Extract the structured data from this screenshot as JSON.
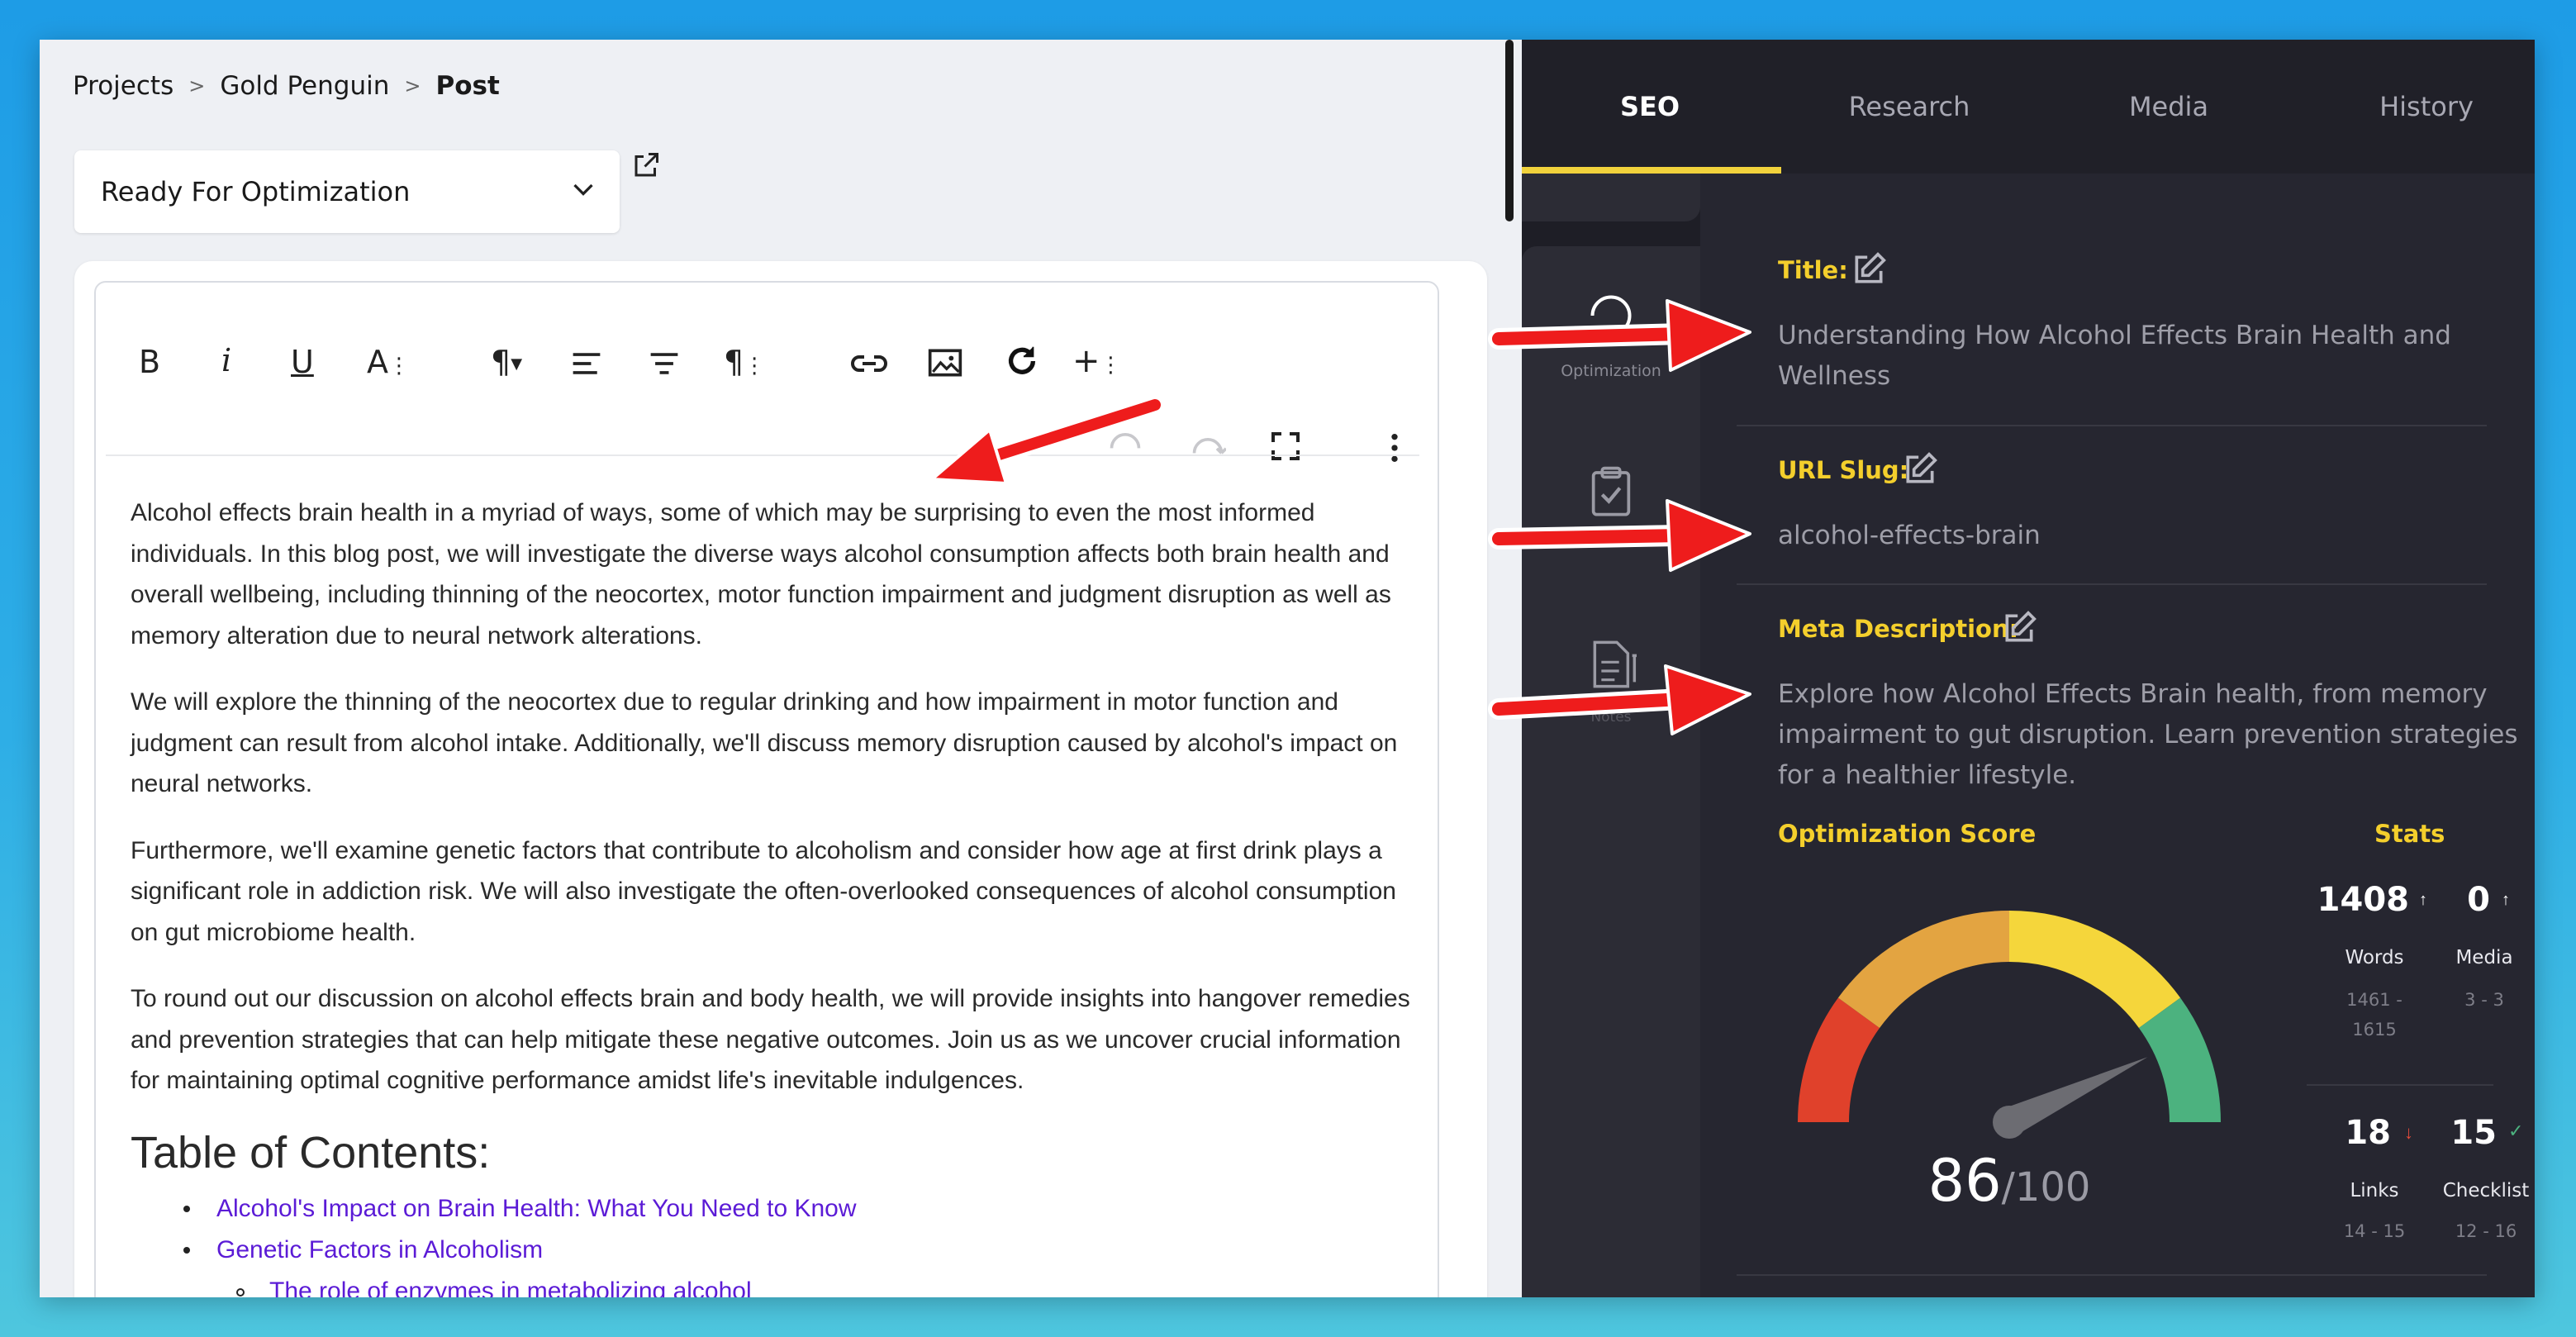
{
  "breadcrumb": {
    "items": [
      "Projects",
      "Gold Penguin"
    ],
    "current": "Post"
  },
  "status_dropdown": {
    "value": "Ready For Optimization"
  },
  "toolbar": {
    "icons": [
      "bold-icon",
      "italic-icon",
      "underline-icon",
      "font-size-icon",
      "paragraph-icon",
      "align-left-icon",
      "align-center-icon",
      "paragraph-format-icon",
      "link-icon",
      "image-icon",
      "redo-icon",
      "insert-more-icon",
      "undo-icon",
      "redo-icon",
      "fullscreen-icon",
      "more-vertical-icon"
    ],
    "bold": "B",
    "italic": "i",
    "underline": "U",
    "font_size": "A"
  },
  "content": {
    "paragraphs": [
      "Alcohol effects brain health in a myriad of ways, some of which may be surprising to even the most informed individuals. In this blog post, we will investigate the diverse ways alcohol consumption affects both brain health and overall wellbeing, including thinning of the neocortex, motor function impairment and judgment disruption as well as memory alteration due to neural network alterations.",
      "We will explore the thinning of the neocortex due to regular drinking and how impairment in motor function and judgment can result from alcohol intake. Additionally, we'll discuss memory disruption caused by alcohol's impact on neural networks.",
      "Furthermore, we'll examine genetic factors that contribute to alcoholism and consider how age at first drink plays a significant role in addiction risk. We will also investigate the often-overlooked consequences of alcohol consumption on gut microbiome health.",
      "To round out our discussion on alcohol effects brain and body health, we will provide insights into hangover remedies and prevention strategies that can help mitigate these negative outcomes. Join us as we uncover crucial information for maintaining optimal cognitive performance amidst life's inevitable indulgences."
    ],
    "toc_heading": "Table of Contents:",
    "toc_items": [
      "Alcohol's Impact on Brain Health: What You Need to Know",
      "Genetic Factors in Alcoholism",
      "The role of enzymes in metabolizing alcohol"
    ]
  },
  "tabs": [
    {
      "label": "SEO",
      "active": true
    },
    {
      "label": "Research"
    },
    {
      "label": "Media"
    },
    {
      "label": "History"
    }
  ],
  "rail": {
    "items": [
      "Optimization",
      "Checklist",
      "Notes"
    ]
  },
  "seo": {
    "title_label": "Title:",
    "title_value": "Understanding How Alcohol Effects Brain Health and Wellness",
    "slug_label": "URL Slug:",
    "slug_value": "alcohol-effects-brain",
    "meta_label": "Meta Description:",
    "meta_value": "Explore how Alcohol Effects Brain health, from memory impairment to gut disruption. Learn prevention strategies for a healthier lifestyle.",
    "score_label": "Optimization Score",
    "score": "86",
    "score_max": "/100",
    "stats_label": "Stats"
  },
  "stats": {
    "words": {
      "value": "1408",
      "label": "Words",
      "range_a": "1461 -",
      "range_b": "1615",
      "trend": "up"
    },
    "media": {
      "value": "0",
      "label": "Media",
      "range": "3 - 3",
      "trend": "up"
    },
    "links": {
      "value": "18",
      "label": "Links",
      "range": "14 - 15",
      "trend": "down"
    },
    "checklist": {
      "value": "15",
      "label": "Checklist",
      "range": "12 - 16",
      "trend": "check"
    }
  },
  "colors": {
    "accent_yellow": "#f4cf2c",
    "gauge_red": "#e0412b",
    "gauge_orange": "#e3a441",
    "gauge_yellow": "#f5d63b",
    "gauge_green": "#4cb27f",
    "link_purple": "#5b1bd6",
    "annotation_arrow": "#ee1c1c"
  }
}
